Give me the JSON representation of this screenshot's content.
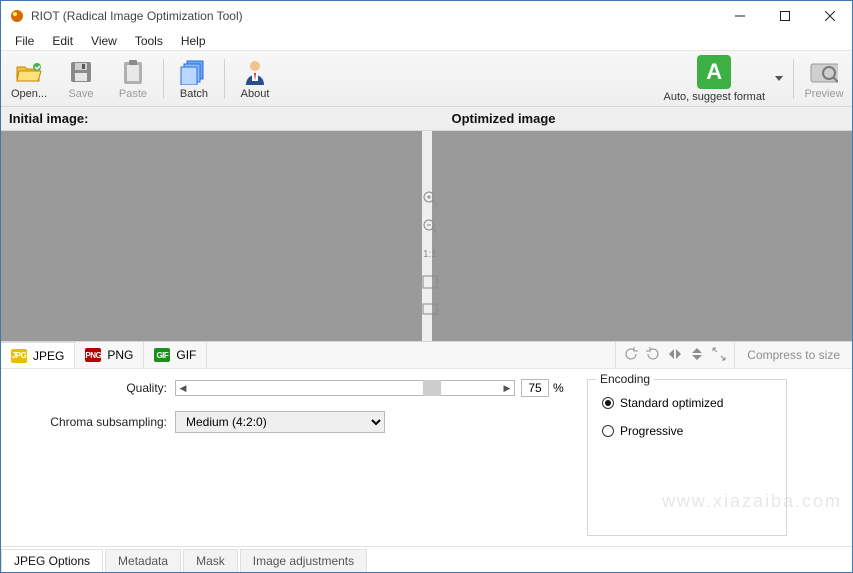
{
  "title": "RIOT (Radical Image Optimization Tool)",
  "menu": [
    "File",
    "Edit",
    "View",
    "Tools",
    "Help"
  ],
  "toolbar": {
    "open": "Open...",
    "save": "Save",
    "paste": "Paste",
    "batch": "Batch",
    "about": "About",
    "auto": "Auto, suggest format",
    "preview": "Preview"
  },
  "panels": {
    "initial": "Initial image:",
    "optimized": "Optimized image"
  },
  "zoom": {
    "oneToOne": "1:1"
  },
  "formats": {
    "jpeg": "JPEG",
    "png": "PNG",
    "gif": "GIF"
  },
  "compress": "Compress to size",
  "jpeg": {
    "quality_label": "Quality:",
    "quality_value": "75",
    "percent": "%",
    "chroma_label": "Chroma subsampling:",
    "chroma_options": [
      "Medium (4:2:0)"
    ],
    "chroma_selected": "Medium (4:2:0)"
  },
  "encoding": {
    "legend": "Encoding",
    "standard": "Standard optimized",
    "progressive": "Progressive",
    "selected": "standard"
  },
  "subtabs": [
    "JPEG Options",
    "Metadata",
    "Mask",
    "Image adjustments"
  ],
  "watermark": "www.xiazaiba.com"
}
